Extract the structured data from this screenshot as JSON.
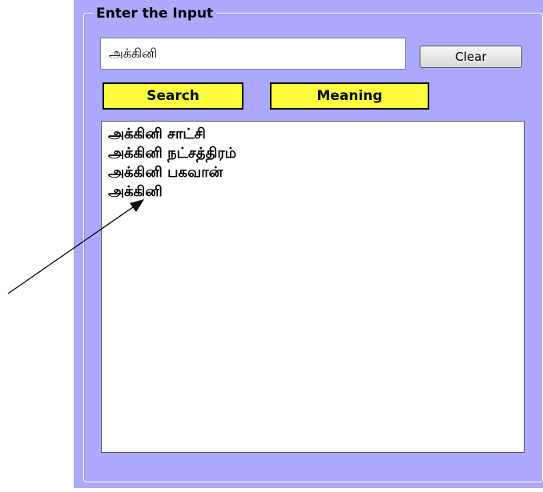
{
  "groupbox": {
    "title": "Enter the Input"
  },
  "search": {
    "value": "அக்கினி"
  },
  "buttons": {
    "clear_label": "Clear",
    "search_label": "Search",
    "meaning_label": "Meaning"
  },
  "results": {
    "items": [
      "அக்கினி சாட்சி",
      "அக்கினி நட்சத்திரம்",
      "அக்கினி பகவான்",
      "அக்கினி"
    ]
  },
  "colors": {
    "panel_background": "#aaaaff",
    "button_yellow": "#ffff40",
    "list_background": "#ffffff"
  }
}
